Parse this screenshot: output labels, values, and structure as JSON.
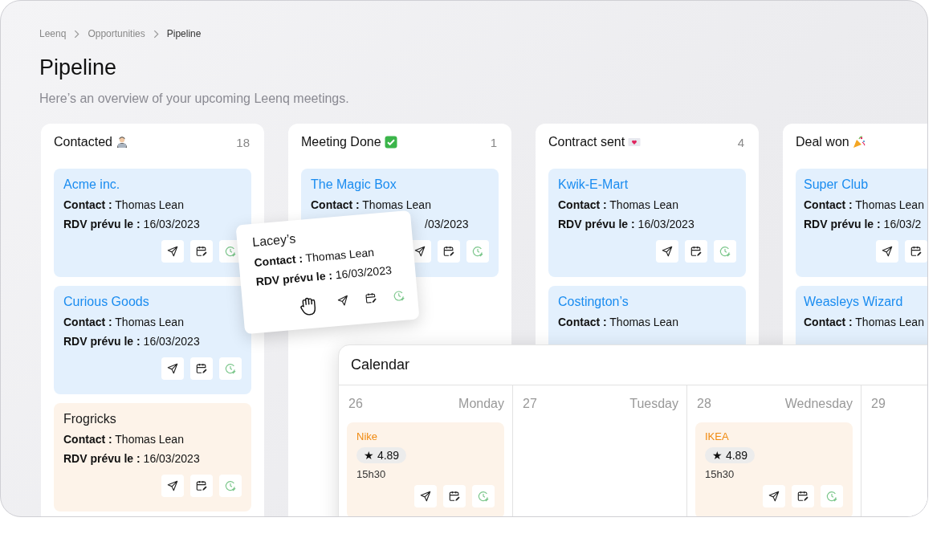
{
  "breadcrumbs": [
    "Leenq",
    "Opportunities",
    "Pipeline"
  ],
  "title": "Pipeline",
  "subtitle": "Here’s an overview of your upcoming Leenq meetings.",
  "columns": [
    {
      "title": "Contacted",
      "kind": "technologist",
      "count": "18",
      "cards": [
        {
          "name": "Acme inc.",
          "color": "#e3f0fd",
          "contact_label": "Contact :",
          "contact": "Thomas Lean",
          "date_label": "RDV prévu le :",
          "date": "16/03/2023"
        },
        {
          "name": "Curious Goods",
          "color": "#e3f0fd",
          "contact_label": "Contact :",
          "contact": "Thomas Lean",
          "date_label": "RDV prévu le :",
          "date": "16/03/2023"
        },
        {
          "name": "Frogricks",
          "color": "#fdf3e9",
          "contact_label": "Contact :",
          "contact": "Thomas Lean",
          "date_label": "RDV prévu le :",
          "date": "16/03/2023"
        }
      ]
    },
    {
      "title": "Meeting Done",
      "kind": "check",
      "count": "1",
      "cards": [
        {
          "name": "The Magic Box",
          "color": "#e3f0fd",
          "contact_label": "Contact :",
          "contact": "Thomas Lean",
          "date": "/03/2023"
        }
      ]
    },
    {
      "title": "Contract sent",
      "kind": "envelope",
      "count": "4",
      "cards": [
        {
          "name": "Kwik-E-Mart",
          "color": "#e3f0fd",
          "contact_label": "Contact :",
          "contact": "Thomas Lean",
          "date_label": "RDV prévu le :",
          "date": "16/03/2023"
        },
        {
          "name": "Costington’s",
          "color": "#e3f0fd",
          "contact_label": "Contact :",
          "contact": "Thomas Lean"
        }
      ]
    },
    {
      "title": "Deal won",
      "kind": "party",
      "cards": [
        {
          "name": "Super Club",
          "color": "#e3f0fd",
          "contact_label": "Contact :",
          "contact": "Thomas Lean",
          "date_label": "RDV prévu le :",
          "date": "16/03/2"
        },
        {
          "name": "Weasleys Wizard",
          "color": "#e3f0fd",
          "contact_label": "Contact :",
          "contact": "Thomas Lean"
        }
      ]
    }
  ],
  "dragged_card": {
    "name": "Lacey’s",
    "contact_label": "Contact :",
    "contact": "Thomas Lean",
    "date_label": "RDV prévu le :",
    "date": "16/03/2023"
  },
  "calendar": {
    "title": "Calendar",
    "days": [
      {
        "number": "26",
        "weekday": "Monday",
        "events": [
          {
            "name": "Nike",
            "rating": "★ 4.89",
            "time": "15h30"
          }
        ]
      },
      {
        "number": "27",
        "weekday": "Tuesday"
      },
      {
        "number": "28",
        "weekday": "Wednesday",
        "events": [
          {
            "name": "IKEA",
            "rating": "★ 4.89",
            "time": "15h30"
          }
        ]
      },
      {
        "number": "29"
      }
    ]
  }
}
